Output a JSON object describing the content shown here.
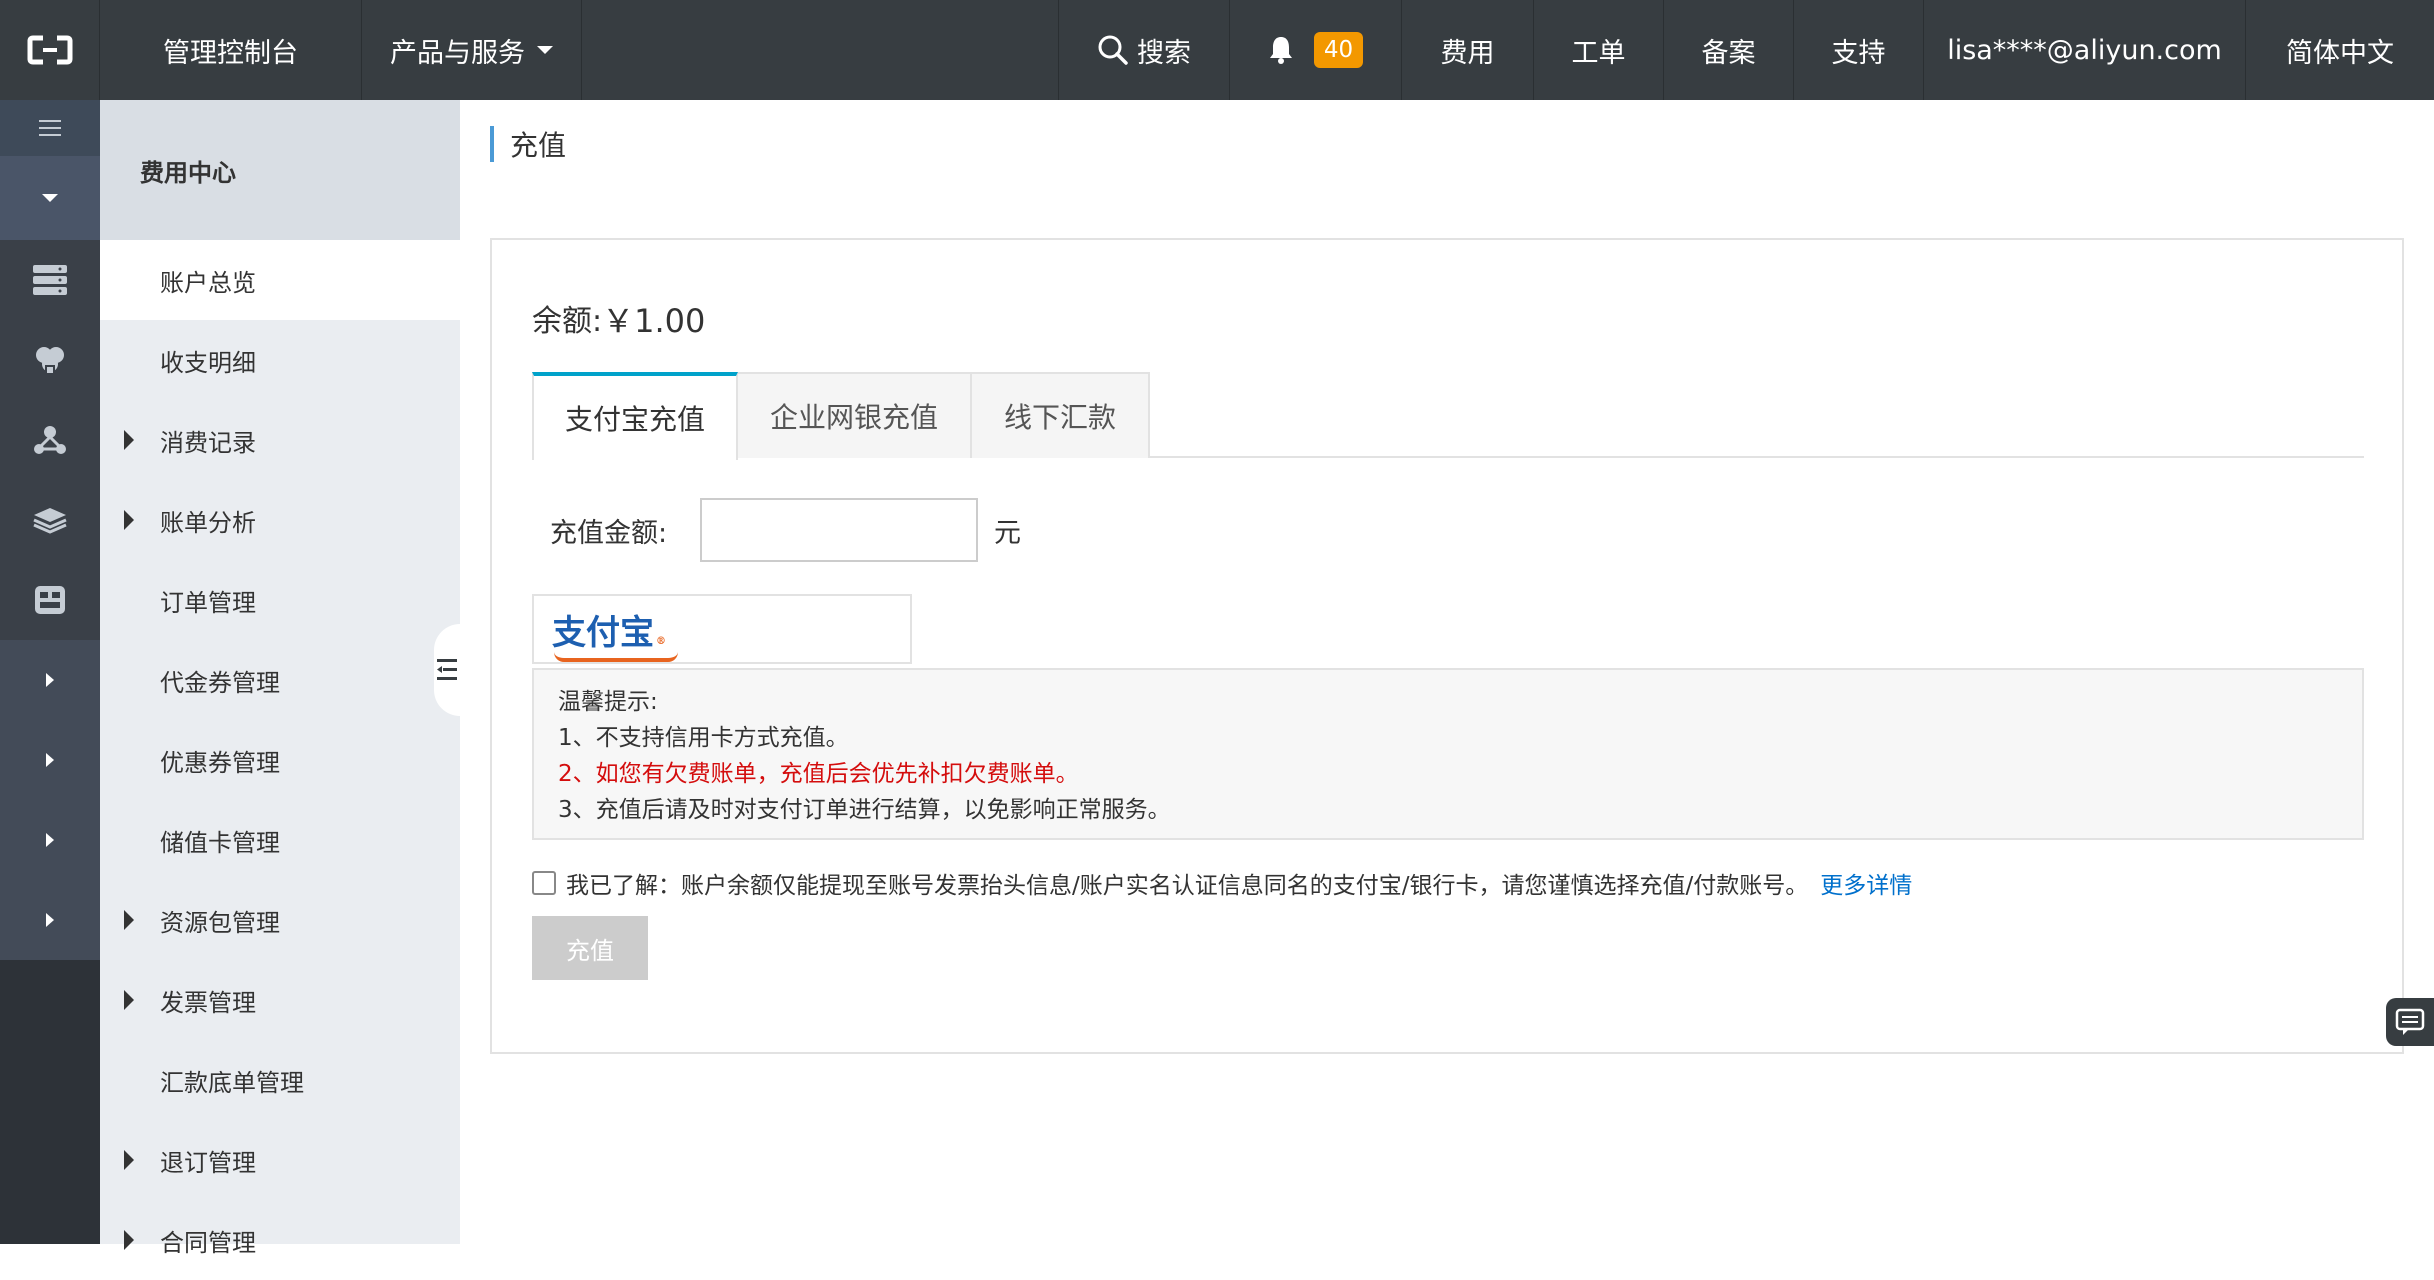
{
  "topbar": {
    "console": "管理控制台",
    "products": "产品与服务",
    "search": "搜索",
    "notification_count": "40",
    "fee": "费用",
    "ticket": "工单",
    "beian": "备案",
    "support": "支持",
    "user_email": "lisa****@aliyun.com",
    "language": "简体中文"
  },
  "rail": {
    "icons": [
      "menu-icon",
      "chevron-down-icon",
      "server-icon",
      "database-icon",
      "network-icon",
      "layers-icon",
      "grid-icon",
      "expand-arrow-icon",
      "expand-arrow-icon",
      "expand-arrow-icon",
      "expand-arrow-icon"
    ]
  },
  "sidebar": {
    "title": "费用中心",
    "items": [
      {
        "label": "账户总览",
        "expandable": false,
        "active": true
      },
      {
        "label": "收支明细",
        "expandable": false
      },
      {
        "label": "消费记录",
        "expandable": true
      },
      {
        "label": "账单分析",
        "expandable": true
      },
      {
        "label": "订单管理",
        "expandable": false
      },
      {
        "label": "代金券管理",
        "expandable": false
      },
      {
        "label": "优惠券管理",
        "expandable": false
      },
      {
        "label": "储值卡管理",
        "expandable": false
      },
      {
        "label": "资源包管理",
        "expandable": true
      },
      {
        "label": "发票管理",
        "expandable": true
      },
      {
        "label": "汇款底单管理",
        "expandable": false
      },
      {
        "label": "退订管理",
        "expandable": true
      },
      {
        "label": "合同管理",
        "expandable": true
      }
    ]
  },
  "main": {
    "page_title": "充值",
    "balance_label": "余额:",
    "balance_value": "￥1.00",
    "tabs": [
      {
        "label": "支付宝充值",
        "active": true
      },
      {
        "label": "企业网银充值"
      },
      {
        "label": "线下汇款"
      }
    ],
    "amount_label": "充值金额:",
    "amount_value": "",
    "amount_unit": "元",
    "alipay_logo_text": "支付宝",
    "tips": {
      "title": "温馨提示:",
      "line1": "1、不支持信用卡方式充值。",
      "line2": "2、如您有欠费账单，充值后会优先补扣欠费账单。",
      "line3": "3、充值后请及时对支付订单进行结算，以免影响正常服务。"
    },
    "agreement_text": "我已了解：账户余额仅能提现至账号发票抬头信息/账户实名认证信息同名的支付宝/银行卡，请您谨慎选择充值/付款账号。",
    "agreement_checked": false,
    "more_link": "更多详情",
    "submit_label": "充值"
  },
  "colors": {
    "topbar_bg": "#373d41",
    "accent_tab": "#00a2ca",
    "badge": "#f39800",
    "warning_red": "#d40d0d",
    "link": "#0070cc",
    "disabled_button": "#cccccc"
  }
}
